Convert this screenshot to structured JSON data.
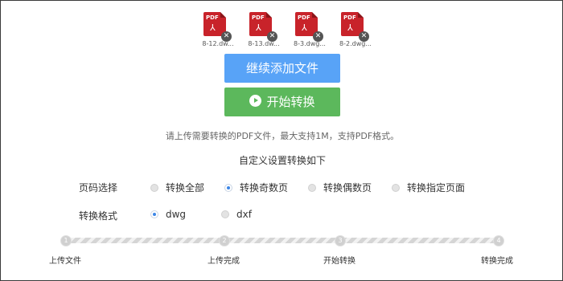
{
  "files": [
    {
      "name": "8-12.dw...",
      "badge": "PDF",
      "icon": "pdf-file-icon"
    },
    {
      "name": "8-13.dw...",
      "badge": "PDF",
      "icon": "pdf-file-icon"
    },
    {
      "name": "8-3.dwg...",
      "badge": "PDF",
      "icon": "pdf-file-icon"
    },
    {
      "name": "8-2.dwg...",
      "badge": "PDF",
      "icon": "pdf-file-icon"
    }
  ],
  "buttons": {
    "add_label": "继续添加文件",
    "start_label": "开始转换"
  },
  "hint": "请上传需要转换的PDF文件，最大支持1M，支持PDF格式。",
  "settings": {
    "title": "自定义设置转换如下",
    "page_label": "页码选择",
    "page_options": [
      {
        "label": "转换全部",
        "checked": false
      },
      {
        "label": "转换奇数页",
        "checked": true
      },
      {
        "label": "转换偶数页",
        "checked": false
      },
      {
        "label": "转换指定页面",
        "checked": false
      }
    ],
    "format_label": "转换格式",
    "format_options": [
      {
        "label": "dwg",
        "checked": true
      },
      {
        "label": "dxf",
        "checked": false
      }
    ]
  },
  "steps": [
    {
      "num": "1",
      "label": "上传文件"
    },
    {
      "num": "2",
      "label": "上传完成"
    },
    {
      "num": "3",
      "label": "开始转换"
    },
    {
      "num": "4",
      "label": "转换完成"
    }
  ],
  "colors": {
    "add_button": "#58a3f7",
    "start_button": "#5cb85c",
    "pdf_red": "#c8232a",
    "radio_checked": "#3c86e6"
  }
}
